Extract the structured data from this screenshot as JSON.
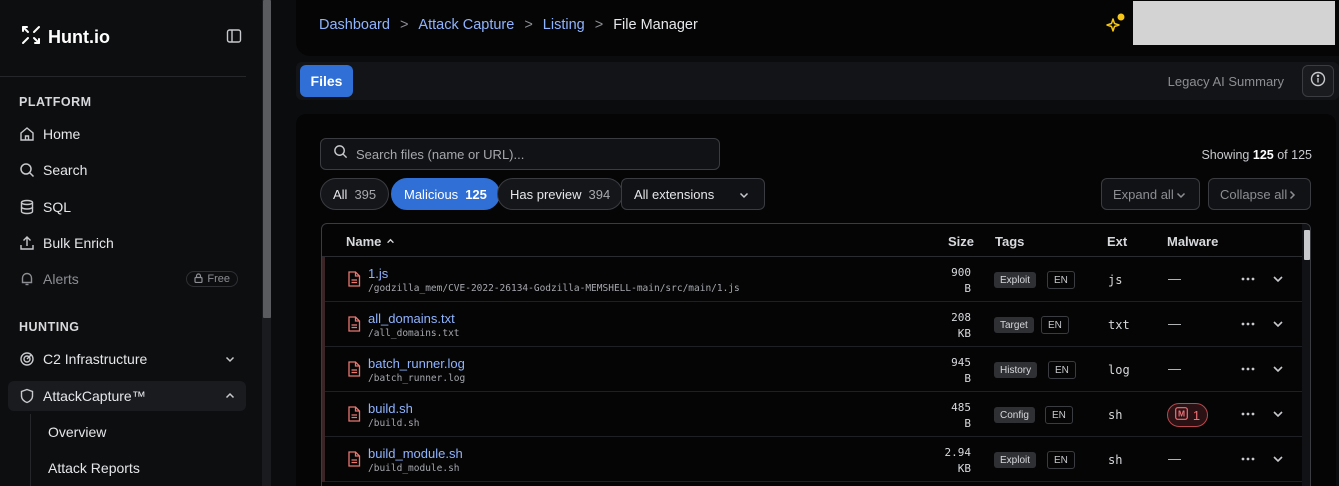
{
  "brand": {
    "name": "Hunt.io"
  },
  "sidebar": {
    "platform_title": "PLATFORM",
    "platform_items": [
      {
        "label": "Home",
        "icon": "home-icon"
      },
      {
        "label": "Search",
        "icon": "search-icon"
      },
      {
        "label": "SQL",
        "icon": "database-icon"
      },
      {
        "label": "Bulk Enrich",
        "icon": "upload-icon"
      },
      {
        "label": "Alerts",
        "icon": "bell-icon",
        "badge": "Free"
      }
    ],
    "hunting_title": "HUNTING",
    "hunting_items": [
      {
        "label": "C2 Infrastructure",
        "icon": "radar-icon"
      },
      {
        "label": "AttackCapture™",
        "icon": "shield-icon"
      }
    ],
    "sub_items": [
      {
        "label": "Overview"
      },
      {
        "label": "Attack Reports"
      }
    ]
  },
  "header": {
    "breadcrumb": [
      "Dashboard",
      "Attack Capture",
      "Listing"
    ],
    "current": "File Manager",
    "sep": ">"
  },
  "filesbar": {
    "tab_label": "Files",
    "legacy_label": "Legacy AI Summary"
  },
  "search": {
    "placeholder": "Search files (name or URL)..."
  },
  "showing": {
    "prefix": "Showing",
    "count": "125",
    "of": "of",
    "total": "125"
  },
  "filters": [
    {
      "label": "All",
      "count": "395"
    },
    {
      "label": "Malicious",
      "count": "125",
      "selected": true
    },
    {
      "label": "Has preview",
      "count": "394"
    }
  ],
  "extensions_select": {
    "value": "All extensions"
  },
  "controls": {
    "expand_all": "Expand all",
    "collapse_all": "Collapse all"
  },
  "table": {
    "columns": {
      "name": "Name",
      "size": "Size",
      "tags": "Tags",
      "ext": "Ext",
      "malware": "Malware"
    },
    "rows": [
      {
        "name": "1.js",
        "path": "/godzilla_mem/CVE-2022-26134-Godzilla-MEMSHELL-main/src/main/1.js",
        "size_value": "900",
        "size_unit": "B",
        "tag": "Exploit",
        "lang": "EN",
        "ext": "js",
        "malware": "—"
      },
      {
        "name": "all_domains.txt",
        "path": "/all_domains.txt",
        "size_value": "208",
        "size_unit": "KB",
        "tag": "Target",
        "lang": "EN",
        "ext": "txt",
        "malware": "—"
      },
      {
        "name": "batch_runner.log",
        "path": "/batch_runner.log",
        "size_value": "945",
        "size_unit": "B",
        "tag": "History",
        "lang": "EN",
        "ext": "log",
        "malware": "—"
      },
      {
        "name": "build.sh",
        "path": "/build.sh",
        "size_value": "485",
        "size_unit": "B",
        "tag": "Config",
        "lang": "EN",
        "ext": "sh",
        "malware_badge": "1",
        "malware_badge_letter": "M"
      },
      {
        "name": "build_module.sh",
        "path": "/build_module.sh",
        "size_value": "2.94",
        "size_unit": "KB",
        "tag": "Exploit",
        "lang": "EN",
        "ext": "sh",
        "malware": "—"
      }
    ]
  },
  "colors": {
    "accent": "#2f6fd6",
    "link": "#8fb4ff",
    "malware": "#f07178"
  }
}
